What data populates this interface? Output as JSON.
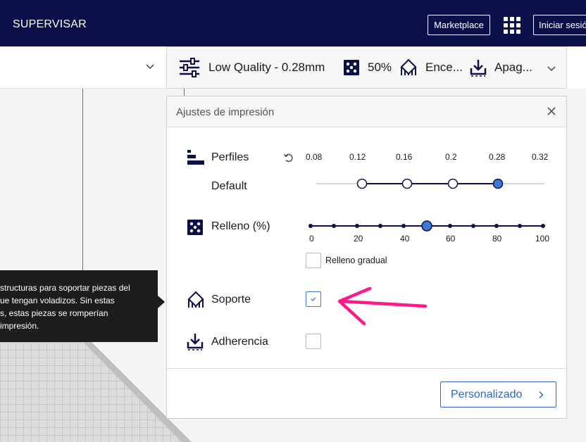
{
  "header": {
    "stage": "SUPERVISAR",
    "marketplace_label": "Marketplace",
    "signin_label": "Iniciar sesió"
  },
  "print_setup": {
    "profile": "Low Quality - 0.28mm",
    "infill": "50%",
    "support": "Ence...",
    "adhesion": "Apag..."
  },
  "panel": {
    "title": "Ajustes de impresión",
    "profiles_label": "Perfiles",
    "profile_default": "Default",
    "layer_heights": [
      "0.08",
      "0.12",
      "0.16",
      "0.2",
      "0.28",
      "0.32"
    ],
    "selected_layer_height": "0.28",
    "infill_label": "Relleno (%)",
    "infill_ticks": [
      "0",
      "20",
      "40",
      "60",
      "80",
      "100"
    ],
    "infill_value": 50,
    "gradual_infill_label": "Relleno gradual",
    "support_label": "Soporte",
    "support_checked": true,
    "adhesion_label": "Adherencia",
    "adhesion_checked": false,
    "custom_button": "Personalizado"
  },
  "tooltip": {
    "lines": [
      "structuras para soportar piezas del",
      "ue tengan voladizos. Sin estas",
      "s, estas piezas se romperían",
      " impresión."
    ]
  },
  "colors": {
    "topbar": "#0c1048",
    "accent": "#2f67c7",
    "slider_knob": "#3c78d8",
    "annotation_arrow": "#ff1a8c"
  }
}
